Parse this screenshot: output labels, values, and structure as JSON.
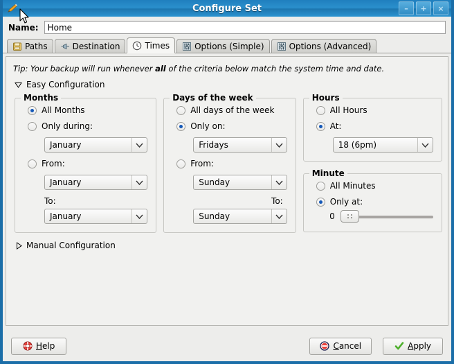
{
  "window": {
    "title": "Configure Set",
    "icon": "pencil-icon",
    "buttons": {
      "minimize": "–",
      "maximize": "+",
      "close": "×"
    },
    "frame_color": "#1b6ea8",
    "titlebar_color": "#2a8fcc"
  },
  "name_field": {
    "label": "Name:",
    "value": "Home",
    "placeholder": ""
  },
  "tabs": [
    {
      "label": "Paths",
      "icon": "folder-icon",
      "active": false
    },
    {
      "label": "Destination",
      "icon": "plug-icon",
      "active": false
    },
    {
      "label": "Times",
      "icon": "clock-icon",
      "active": true
    },
    {
      "label": "Options (Simple)",
      "icon": "sliders-icon",
      "active": false
    },
    {
      "label": "Options (Advanced)",
      "icon": "sliders-icon",
      "active": false
    }
  ],
  "tip": {
    "prefix": "Tip: Your backup will run whenever ",
    "bold": "all",
    "suffix": " of the criteria below match the system time and date."
  },
  "easy_configuration": {
    "label": "Easy Configuration",
    "expanded": true,
    "arrow": "triangle-down"
  },
  "manual_configuration": {
    "label": "Manual Configuration",
    "expanded": false,
    "arrow": "triangle-right"
  },
  "months": {
    "legend": "Months",
    "all": {
      "label": "All Months",
      "selected": true
    },
    "only_during": {
      "label": "Only during:",
      "selected": false,
      "value": "January"
    },
    "from": {
      "label": "From:",
      "selected": false,
      "value": "January"
    },
    "to": {
      "label": "To:",
      "value": "January"
    }
  },
  "days": {
    "legend": "Days of the week",
    "all": {
      "label": "All days of the week",
      "selected": false
    },
    "only_on": {
      "label": "Only on:",
      "selected": true,
      "value": "Fridays"
    },
    "from": {
      "label": "From:",
      "selected": false,
      "value": "Sunday"
    },
    "to": {
      "label": "To:",
      "value": "Sunday"
    }
  },
  "hours": {
    "legend": "Hours",
    "all": {
      "label": "All Hours",
      "selected": false
    },
    "at": {
      "label": "At:",
      "selected": true,
      "value": "18 (6pm)"
    }
  },
  "minute": {
    "legend": "Minute",
    "all": {
      "label": "All Minutes",
      "selected": false
    },
    "only_at": {
      "label": "Only at:",
      "selected": true
    },
    "slider": {
      "value": "0",
      "min": 0,
      "max": 59,
      "position_percent": 0
    }
  },
  "footer": {
    "help": {
      "label": "Help",
      "icon": "lifering-icon",
      "accel": "H"
    },
    "cancel": {
      "label": "Cancel",
      "icon": "no-entry-icon",
      "accel": "C"
    },
    "apply": {
      "label": "Apply",
      "icon": "checkmark-icon",
      "accel": "A"
    }
  }
}
